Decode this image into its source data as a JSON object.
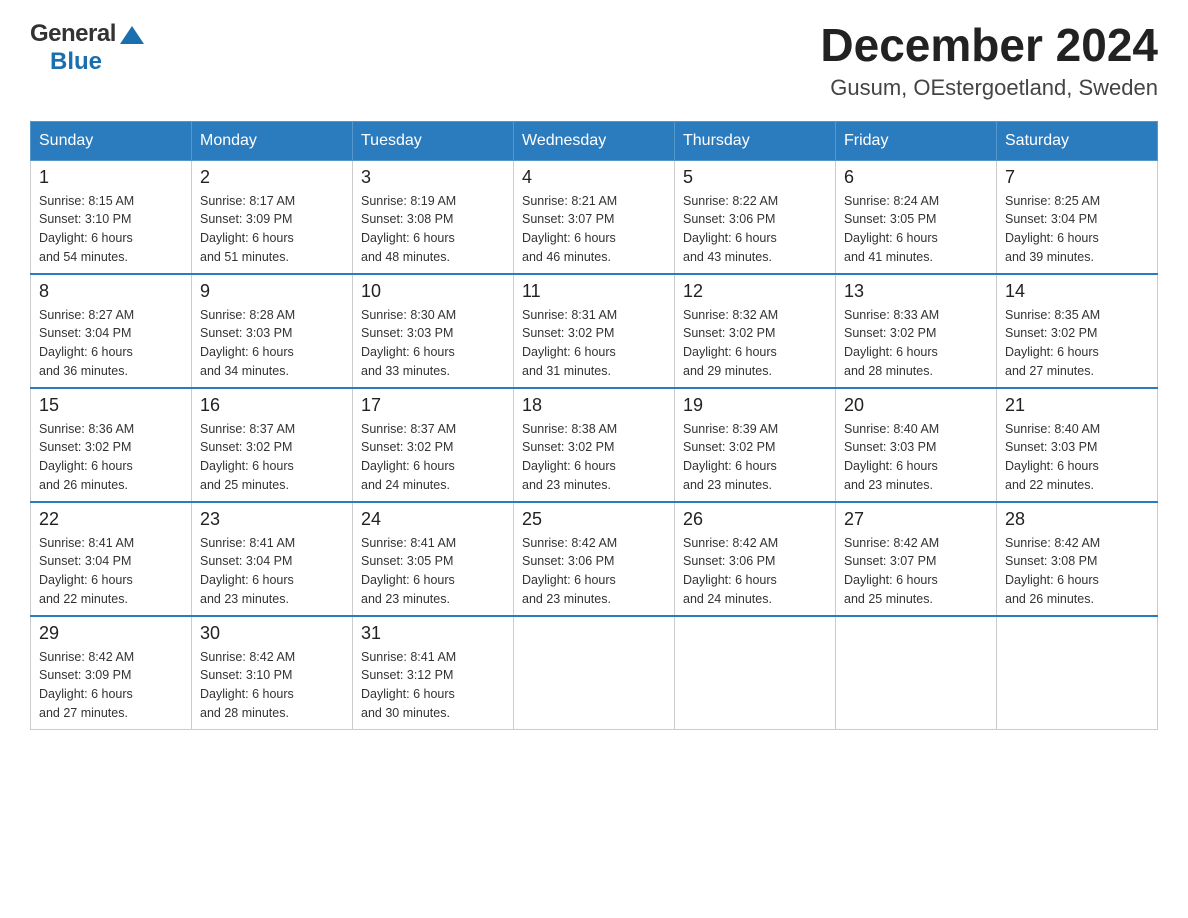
{
  "header": {
    "title": "December 2024",
    "location": "Gusum, OEstergoetland, Sweden",
    "logo_general": "General",
    "logo_blue": "Blue"
  },
  "weekdays": [
    "Sunday",
    "Monday",
    "Tuesday",
    "Wednesday",
    "Thursday",
    "Friday",
    "Saturday"
  ],
  "weeks": [
    [
      {
        "day": "1",
        "sunrise": "Sunrise: 8:15 AM",
        "sunset": "Sunset: 3:10 PM",
        "daylight": "Daylight: 6 hours",
        "daylight2": "and 54 minutes."
      },
      {
        "day": "2",
        "sunrise": "Sunrise: 8:17 AM",
        "sunset": "Sunset: 3:09 PM",
        "daylight": "Daylight: 6 hours",
        "daylight2": "and 51 minutes."
      },
      {
        "day": "3",
        "sunrise": "Sunrise: 8:19 AM",
        "sunset": "Sunset: 3:08 PM",
        "daylight": "Daylight: 6 hours",
        "daylight2": "and 48 minutes."
      },
      {
        "day": "4",
        "sunrise": "Sunrise: 8:21 AM",
        "sunset": "Sunset: 3:07 PM",
        "daylight": "Daylight: 6 hours",
        "daylight2": "and 46 minutes."
      },
      {
        "day": "5",
        "sunrise": "Sunrise: 8:22 AM",
        "sunset": "Sunset: 3:06 PM",
        "daylight": "Daylight: 6 hours",
        "daylight2": "and 43 minutes."
      },
      {
        "day": "6",
        "sunrise": "Sunrise: 8:24 AM",
        "sunset": "Sunset: 3:05 PM",
        "daylight": "Daylight: 6 hours",
        "daylight2": "and 41 minutes."
      },
      {
        "day": "7",
        "sunrise": "Sunrise: 8:25 AM",
        "sunset": "Sunset: 3:04 PM",
        "daylight": "Daylight: 6 hours",
        "daylight2": "and 39 minutes."
      }
    ],
    [
      {
        "day": "8",
        "sunrise": "Sunrise: 8:27 AM",
        "sunset": "Sunset: 3:04 PM",
        "daylight": "Daylight: 6 hours",
        "daylight2": "and 36 minutes."
      },
      {
        "day": "9",
        "sunrise": "Sunrise: 8:28 AM",
        "sunset": "Sunset: 3:03 PM",
        "daylight": "Daylight: 6 hours",
        "daylight2": "and 34 minutes."
      },
      {
        "day": "10",
        "sunrise": "Sunrise: 8:30 AM",
        "sunset": "Sunset: 3:03 PM",
        "daylight": "Daylight: 6 hours",
        "daylight2": "and 33 minutes."
      },
      {
        "day": "11",
        "sunrise": "Sunrise: 8:31 AM",
        "sunset": "Sunset: 3:02 PM",
        "daylight": "Daylight: 6 hours",
        "daylight2": "and 31 minutes."
      },
      {
        "day": "12",
        "sunrise": "Sunrise: 8:32 AM",
        "sunset": "Sunset: 3:02 PM",
        "daylight": "Daylight: 6 hours",
        "daylight2": "and 29 minutes."
      },
      {
        "day": "13",
        "sunrise": "Sunrise: 8:33 AM",
        "sunset": "Sunset: 3:02 PM",
        "daylight": "Daylight: 6 hours",
        "daylight2": "and 28 minutes."
      },
      {
        "day": "14",
        "sunrise": "Sunrise: 8:35 AM",
        "sunset": "Sunset: 3:02 PM",
        "daylight": "Daylight: 6 hours",
        "daylight2": "and 27 minutes."
      }
    ],
    [
      {
        "day": "15",
        "sunrise": "Sunrise: 8:36 AM",
        "sunset": "Sunset: 3:02 PM",
        "daylight": "Daylight: 6 hours",
        "daylight2": "and 26 minutes."
      },
      {
        "day": "16",
        "sunrise": "Sunrise: 8:37 AM",
        "sunset": "Sunset: 3:02 PM",
        "daylight": "Daylight: 6 hours",
        "daylight2": "and 25 minutes."
      },
      {
        "day": "17",
        "sunrise": "Sunrise: 8:37 AM",
        "sunset": "Sunset: 3:02 PM",
        "daylight": "Daylight: 6 hours",
        "daylight2": "and 24 minutes."
      },
      {
        "day": "18",
        "sunrise": "Sunrise: 8:38 AM",
        "sunset": "Sunset: 3:02 PM",
        "daylight": "Daylight: 6 hours",
        "daylight2": "and 23 minutes."
      },
      {
        "day": "19",
        "sunrise": "Sunrise: 8:39 AM",
        "sunset": "Sunset: 3:02 PM",
        "daylight": "Daylight: 6 hours",
        "daylight2": "and 23 minutes."
      },
      {
        "day": "20",
        "sunrise": "Sunrise: 8:40 AM",
        "sunset": "Sunset: 3:03 PM",
        "daylight": "Daylight: 6 hours",
        "daylight2": "and 23 minutes."
      },
      {
        "day": "21",
        "sunrise": "Sunrise: 8:40 AM",
        "sunset": "Sunset: 3:03 PM",
        "daylight": "Daylight: 6 hours",
        "daylight2": "and 22 minutes."
      }
    ],
    [
      {
        "day": "22",
        "sunrise": "Sunrise: 8:41 AM",
        "sunset": "Sunset: 3:04 PM",
        "daylight": "Daylight: 6 hours",
        "daylight2": "and 22 minutes."
      },
      {
        "day": "23",
        "sunrise": "Sunrise: 8:41 AM",
        "sunset": "Sunset: 3:04 PM",
        "daylight": "Daylight: 6 hours",
        "daylight2": "and 23 minutes."
      },
      {
        "day": "24",
        "sunrise": "Sunrise: 8:41 AM",
        "sunset": "Sunset: 3:05 PM",
        "daylight": "Daylight: 6 hours",
        "daylight2": "and 23 minutes."
      },
      {
        "day": "25",
        "sunrise": "Sunrise: 8:42 AM",
        "sunset": "Sunset: 3:06 PM",
        "daylight": "Daylight: 6 hours",
        "daylight2": "and 23 minutes."
      },
      {
        "day": "26",
        "sunrise": "Sunrise: 8:42 AM",
        "sunset": "Sunset: 3:06 PM",
        "daylight": "Daylight: 6 hours",
        "daylight2": "and 24 minutes."
      },
      {
        "day": "27",
        "sunrise": "Sunrise: 8:42 AM",
        "sunset": "Sunset: 3:07 PM",
        "daylight": "Daylight: 6 hours",
        "daylight2": "and 25 minutes."
      },
      {
        "day": "28",
        "sunrise": "Sunrise: 8:42 AM",
        "sunset": "Sunset: 3:08 PM",
        "daylight": "Daylight: 6 hours",
        "daylight2": "and 26 minutes."
      }
    ],
    [
      {
        "day": "29",
        "sunrise": "Sunrise: 8:42 AM",
        "sunset": "Sunset: 3:09 PM",
        "daylight": "Daylight: 6 hours",
        "daylight2": "and 27 minutes."
      },
      {
        "day": "30",
        "sunrise": "Sunrise: 8:42 AM",
        "sunset": "Sunset: 3:10 PM",
        "daylight": "Daylight: 6 hours",
        "daylight2": "and 28 minutes."
      },
      {
        "day": "31",
        "sunrise": "Sunrise: 8:41 AM",
        "sunset": "Sunset: 3:12 PM",
        "daylight": "Daylight: 6 hours",
        "daylight2": "and 30 minutes."
      },
      null,
      null,
      null,
      null
    ]
  ]
}
